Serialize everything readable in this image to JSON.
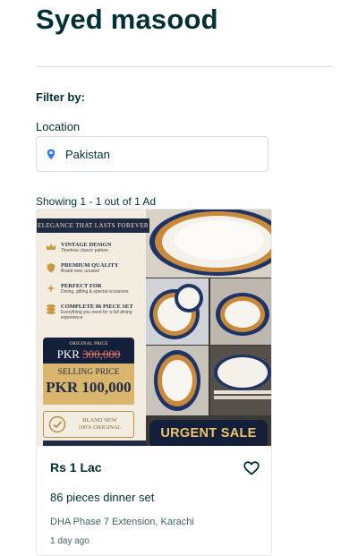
{
  "profile": {
    "name": "Syed masood"
  },
  "filter": {
    "title": "Filter by:",
    "location_label": "Location",
    "location_value": "Pakistan"
  },
  "results": {
    "showing_text": "Showing 1 - 1 out of 1 Ad"
  },
  "ad": {
    "price": "Rs 1 Lac",
    "title": "86 pieces dinner set",
    "location": "DHA Phase 7 Extension, Karachi",
    "posted": "1 day ago",
    "image": {
      "banner": "ELEGANCE THAT LASTS FOREVER",
      "features": [
        {
          "title": "VINTAGE DESIGN",
          "desc": "Timeless classic pattern",
          "icon": "crown-icon"
        },
        {
          "title": "PREMIUM QUALITY",
          "desc": "Brand new, unused",
          "icon": "shield-icon"
        },
        {
          "title": "PERFECT FOR",
          "desc": "Dining, gifting & special occasions",
          "icon": "sparkle-icon"
        },
        {
          "title": "COMPLETE 86 PIECE SET",
          "desc": "Everything you need for a full dining experience",
          "icon": "stack-icon"
        }
      ],
      "original_label": "ORIGINAL PRICE",
      "original_currency": "PKR",
      "original_amount": "300,000",
      "selling_label": "SELLING PRICE",
      "selling_price": "PKR 100,000",
      "badge_line1": "BLAND NEW",
      "badge_line2": "100% ORIGINAL",
      "urgent": "URGENT SALE"
    }
  },
  "colors": {
    "text": "#002f34",
    "muted": "#406367",
    "navy": "#14203a",
    "gold": "#d9b56e",
    "pin": "#3a77ff"
  }
}
